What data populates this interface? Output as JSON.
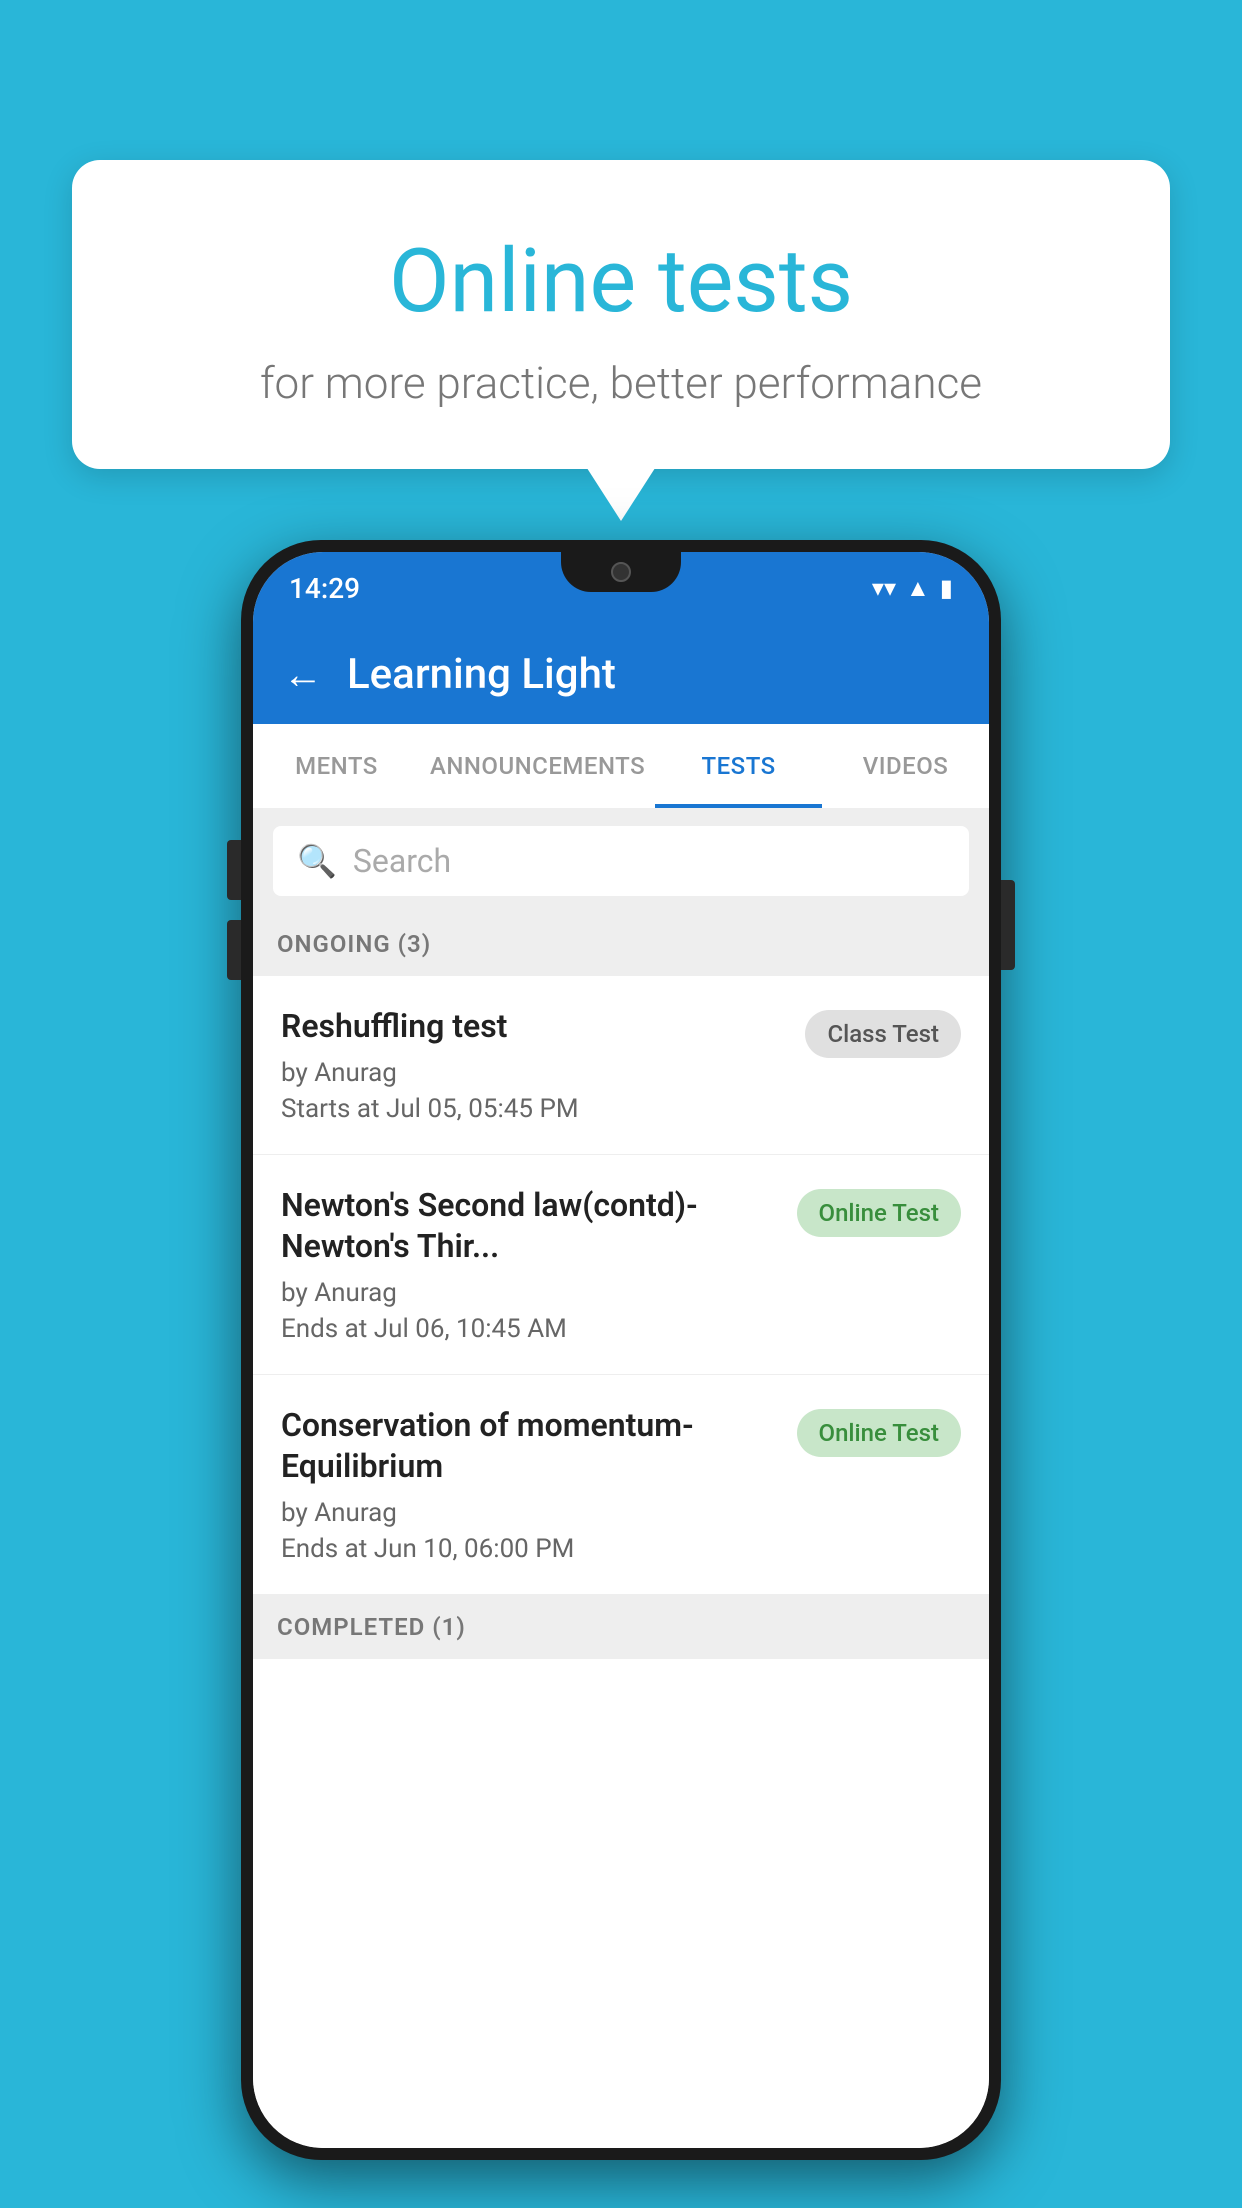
{
  "background_color": "#29b6d8",
  "bubble": {
    "title": "Online tests",
    "subtitle": "for more practice, better performance"
  },
  "status_bar": {
    "time": "14:29",
    "icons": [
      "wifi",
      "signal",
      "battery"
    ]
  },
  "app_bar": {
    "title": "Learning Light",
    "back_label": "←"
  },
  "tabs": [
    {
      "label": "MENTS",
      "active": false
    },
    {
      "label": "ANNOUNCEMENTS",
      "active": false
    },
    {
      "label": "TESTS",
      "active": true
    },
    {
      "label": "VIDEOS",
      "active": false
    }
  ],
  "search": {
    "placeholder": "Search"
  },
  "sections": {
    "ongoing": {
      "header": "ONGOING (3)",
      "tests": [
        {
          "title": "Reshuffling test",
          "author": "by Anurag",
          "time": "Starts at  Jul 05, 05:45 PM",
          "badge": "Class Test",
          "badge_type": "class"
        },
        {
          "title": "Newton's Second law(contd)-Newton's Thir...",
          "author": "by Anurag",
          "time": "Ends at  Jul 06, 10:45 AM",
          "badge": "Online Test",
          "badge_type": "online"
        },
        {
          "title": "Conservation of momentum-Equilibrium",
          "author": "by Anurag",
          "time": "Ends at  Jun 10, 06:00 PM",
          "badge": "Online Test",
          "badge_type": "online"
        }
      ]
    },
    "completed": {
      "header": "COMPLETED (1)"
    }
  }
}
